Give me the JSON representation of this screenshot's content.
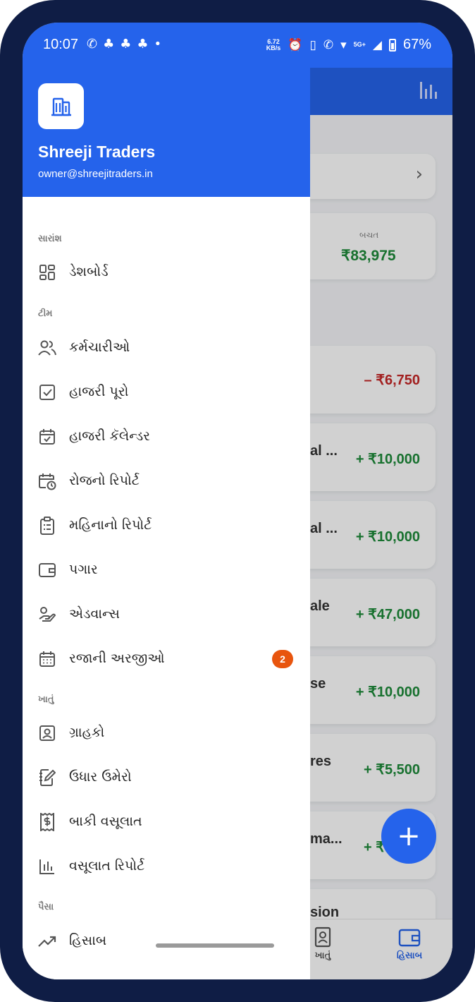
{
  "status_bar": {
    "time": "10:07",
    "app_icons": [
      "whatsapp-icon",
      "snapchat-icon",
      "snapchat-icon",
      "snapchat-icon"
    ],
    "dot": "•",
    "net_speed_value": "6.72",
    "net_speed_unit": "KB/s",
    "network": "5G+",
    "battery": "67%"
  },
  "drawer": {
    "business_name": "Shreeji Traders",
    "email": "owner@shreejitraders.in",
    "sections": {
      "summary": "સારાંશ",
      "team": "ટીમ",
      "account": "ખાતું",
      "money": "પૈસા"
    },
    "items": {
      "dashboard": "ડેશબોર્ડ",
      "employees": "કર્મચારીઓ",
      "mark_attendance": "હાજરી પૂરો",
      "attendance_calendar": "હાજરી કૅલેન્ડર",
      "daily_report": "રોજનો રિપોર્ટ",
      "monthly_report": "મહિનાનો રિપોર્ટ",
      "salary": "પગાર",
      "advance": "એડવાન્સ",
      "leave_requests": "રજાની અરજીઓ",
      "customers": "ગ્રાહકો",
      "add_credit": "ઉધાર ઉમેરો",
      "pending_collection": "બાકી વસૂલાત",
      "collection_report": "વસૂલાત રિપોર્ટ",
      "accounts": "હિસાબ"
    },
    "leave_badge": "2"
  },
  "background": {
    "savings_label": "બચત",
    "savings_value": "₹83,975",
    "transactions": [
      {
        "fragment": "",
        "amount": "– ₹6,750"
      },
      {
        "fragment": "al ...",
        "amount": "+ ₹10,000"
      },
      {
        "fragment": "al ...",
        "amount": "+ ₹10,000"
      },
      {
        "fragment": "ale",
        "amount": "+ ₹47,000"
      },
      {
        "fragment": "se",
        "amount": "+ ₹10,000"
      },
      {
        "fragment": "res",
        "amount": "+ ₹5,500"
      },
      {
        "fragment": "ma...",
        "amount": "+ ₹7,500"
      },
      {
        "fragment": "sion",
        "amount": ""
      }
    ],
    "bottom_nav": {
      "account": "ખાતું",
      "accounts": "હિસાબ"
    },
    "fab_symbol": "+"
  },
  "colors": {
    "brand": "#2563eb",
    "positive": "#1e8a3a",
    "negative": "#c62828",
    "badge": "#e8550e"
  }
}
